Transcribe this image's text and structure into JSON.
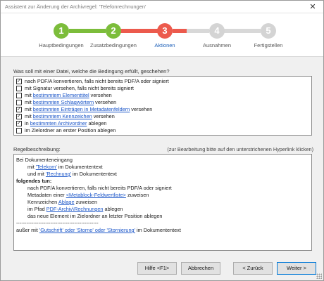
{
  "window": {
    "title": "Assistent zur Änderung der Archivregel: 'Telefonrechnungen'",
    "close": "✕"
  },
  "steps": [
    {
      "number": "1",
      "label": "Hauptbedingungen",
      "state": "done"
    },
    {
      "number": "2",
      "label": "Zusatzbedingungen",
      "state": "done"
    },
    {
      "number": "3",
      "label": "Aktionen",
      "state": "active"
    },
    {
      "number": "4",
      "label": "Ausnahmen",
      "state": "todo"
    },
    {
      "number": "5",
      "label": "Fertigstellen",
      "state": "todo"
    }
  ],
  "colors": {
    "done": "#7cbd3b",
    "active": "#ec5a4d",
    "todo": "#d4d4d4",
    "link": "#1a55c8"
  },
  "question": "Was soll mit einer Datei, welche die Bedingung erfüllt, geschehen?",
  "actions": [
    {
      "checked": true,
      "pre": "nach PDF/A konvertieren, falls nicht bereits PDF/A oder signiert",
      "link": "",
      "post": ""
    },
    {
      "checked": false,
      "pre": "mit Signatur versehen, falls nicht bereits signiert",
      "link": "",
      "post": ""
    },
    {
      "checked": false,
      "pre": "mit ",
      "link": "bestimmtem Elementtitel",
      "post": " versehen"
    },
    {
      "checked": false,
      "pre": "mit ",
      "link": "bestimmten Schlagwörtern",
      "post": " versehen"
    },
    {
      "checked": true,
      "pre": "mit ",
      "link": "bestimmten Einträgen in Metadatenfeldern",
      "post": " versehen"
    },
    {
      "checked": true,
      "pre": "mit ",
      "link": "bestimmtem Kennzeichen",
      "post": " versehen"
    },
    {
      "checked": true,
      "pre": "in ",
      "link": "bestimmten Archivordner",
      "post": " ablegen"
    },
    {
      "checked": false,
      "pre": "im Zielordner an erster Position ablegen",
      "link": "",
      "post": ""
    }
  ],
  "rule_label": "Regelbeschreibung:",
  "rule_hint": "(zur Bearbeitung bitte auf den unterstrichenen Hyperlink klicken)",
  "rule": {
    "l1": "Bei Dokumenteneingang",
    "l2_pre": "mit ",
    "l2_link": "'Telekom'",
    "l2_post": " im Dokumententext",
    "l3_pre": "und mit ",
    "l3_link": "'Rechnung'",
    "l3_post": " im Dokumententext",
    "l4": "folgendes tun:",
    "l5": "nach PDF/A konvertieren, falls nicht bereits PDF/A oder signiert",
    "l6_pre": "Metadaten einer ",
    "l6_link": "<Metablock-Feldwertliste>",
    "l6_post": " zuweisen",
    "l7_pre": "Kennzeichen ",
    "l7_link": "Ablage",
    "l7_post": " zuweisen",
    "l8_pre": "im Pfad ",
    "l8_link": "PDF-Archiv\\Rechnungen",
    "l8_post": " ablegen",
    "l9": "das neue Element im Zielordner an letzter Position ablegen",
    "l10": "------------------------------------------------",
    "l11_pre": "außer mit ",
    "l11_link": "'Gutschrift' oder 'Storno' oder 'Stornierung'",
    "l11_post": " im Dokumententext"
  },
  "buttons": {
    "help": "Hilfe <F1>",
    "cancel": "Abbrechen",
    "back": "< Zurück",
    "next": "Weiter >"
  }
}
